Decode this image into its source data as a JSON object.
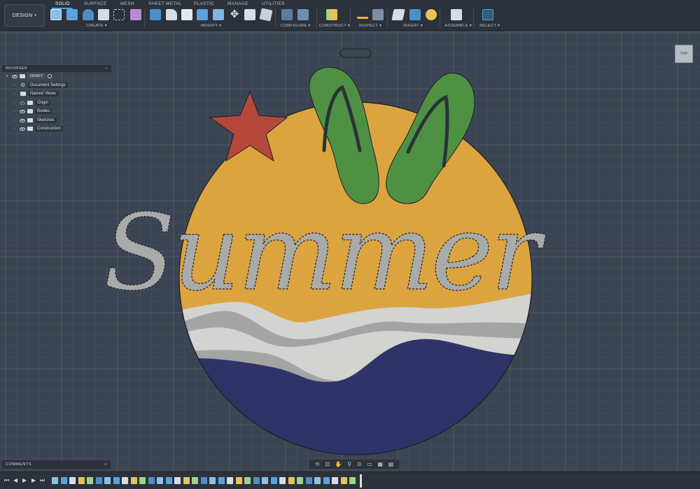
{
  "workspace": {
    "label": "DESIGN"
  },
  "tabs": [
    "SOLID",
    "SURFACE",
    "MESH",
    "SHEET METAL",
    "PLASTIC",
    "MANAGE",
    "UTILITIES"
  ],
  "active_tab": "SOLID",
  "groups": [
    "CREATE",
    "MODIFY",
    "CONFIGURE",
    "CONSTRUCT",
    "INSPECT",
    "INSERT",
    "ASSEMBLE",
    "SELECT"
  ],
  "browser": {
    "title": "BROWSER",
    "root": "DRAFT",
    "items": [
      "Document Settings",
      "Named Views",
      "Origin",
      "Bodies",
      "Sketches",
      "Construction"
    ]
  },
  "viewcube": {
    "face": "TOP"
  },
  "comments": {
    "title": "COMMENTS",
    "add": "+"
  },
  "model": {
    "text": "Summer",
    "colors": {
      "sky": "#dca43f",
      "starfish": "#b5483b",
      "flipflop": "#4f9143",
      "strap": "#28333a",
      "wave_light": "#d3d4d1",
      "wave_mid": "#a3a5a4",
      "sea": "#2f3468",
      "lettering": "#a9abaa"
    }
  },
  "theme": {
    "background": "#3b4452",
    "toolbar": "#2c313a",
    "accent": "#4aa3df"
  }
}
